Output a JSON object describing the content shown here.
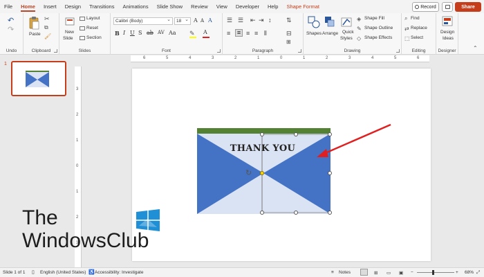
{
  "tabs": [
    "File",
    "Home",
    "Insert",
    "Design",
    "Transitions",
    "Animations",
    "Slide Show",
    "Review",
    "View",
    "Developer",
    "Help",
    "Shape Format"
  ],
  "active_tab": "Home",
  "header": {
    "record_label": "Record",
    "share_label": "Share"
  },
  "ribbon": {
    "undo_label": "Undo",
    "clipboard": {
      "paste": "Paste",
      "label": "Clipboard"
    },
    "slides": {
      "new_slide": "New",
      "new_slide2": "Slide",
      "layout": "Layout",
      "reset": "Reset",
      "section": "Section",
      "label": "Slides"
    },
    "font": {
      "name": "Calibri (Body)",
      "size": "18",
      "label": "Font"
    },
    "paragraph": {
      "label": "Paragraph"
    },
    "drawing": {
      "shapes": "Shapes",
      "arrange": "Arrange",
      "quick_styles": "Quick",
      "quick_styles2": "Styles",
      "shape_fill": "Shape Fill",
      "shape_outline": "Shape Outline",
      "shape_effects": "Shape Effects",
      "label": "Drawing"
    },
    "editing": {
      "find": "Find",
      "replace": "Replace",
      "select": "Select",
      "label": "Editing"
    },
    "designer": {
      "design_ideas": "Design",
      "design_ideas2": "Ideas",
      "label": "Designer"
    }
  },
  "slides_pane": {
    "slide_number": "1"
  },
  "ruler": {
    "h_ticks": [
      "6",
      "5",
      "4",
      "3",
      "2",
      "1",
      "0",
      "1",
      "2",
      "3",
      "4",
      "5",
      "6"
    ],
    "v_ticks": [
      "3",
      "2",
      "1",
      "0",
      "1",
      "2",
      "3"
    ]
  },
  "slide": {
    "text": "THANK YOU"
  },
  "watermark": {
    "line1": "The",
    "line2": "WindowsClub"
  },
  "status": {
    "slide_info": "Slide 1 of 1",
    "language": "English (United States)",
    "accessibility": "Accessibility: Investigate",
    "notes": "Notes",
    "zoom": "68%"
  },
  "colors": {
    "accent": "#c43e1c",
    "envelope_blue": "#4472c4",
    "envelope_light": "#dae3f3",
    "green_bar": "#548235",
    "arrow": "#e02020"
  }
}
